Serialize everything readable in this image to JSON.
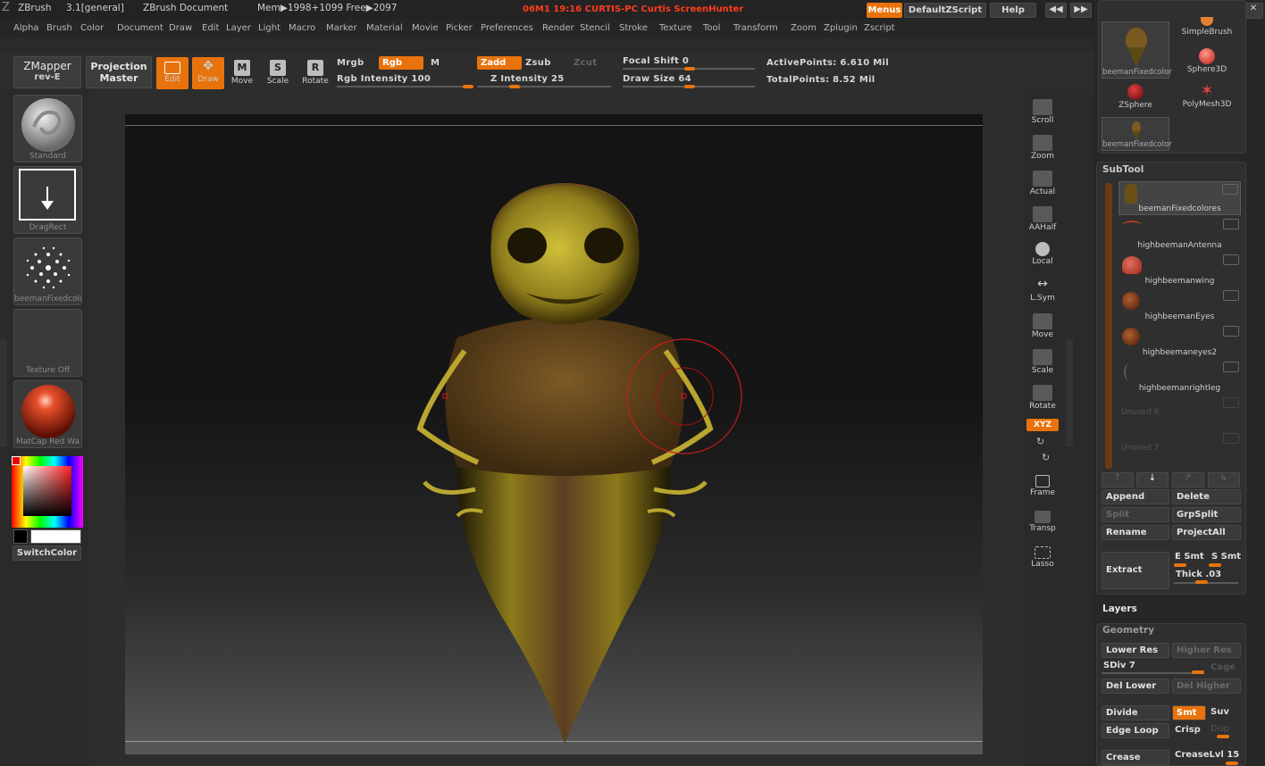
{
  "titlebar": {
    "app": "ZBrush",
    "version": "3.1[general]",
    "document": "ZBrush Document",
    "mem": "Mem▶1998+1099 Free▶2097",
    "status": "06M1 19:16 CURTIS-PC Curtis ScreenHunter",
    "menus_btn": "Menus",
    "script_btn": "DefaultZScript",
    "help_btn": "Help"
  },
  "menu": [
    "Alpha",
    "Brush",
    "Color",
    "Document",
    "Draw",
    "Edit",
    "Layer",
    "Light",
    "Macro",
    "Marker",
    "Material",
    "Movie",
    "Picker",
    "Preferences",
    "Render",
    "Stencil",
    "Stroke",
    "Texture",
    "Tool",
    "Transform",
    "Zoom",
    "Zplugin",
    "Zscript"
  ],
  "shelf": {
    "zmapper": "ZMapper",
    "zmapper_sub": "rev-E",
    "projection": "Projection",
    "projection_sub": "Master",
    "edit": "Edit",
    "draw": "Draw",
    "move": "Move",
    "scale": "Scale",
    "rotate": "Rotate",
    "mrgb": "Mrgb",
    "rgb": "Rgb",
    "m": "M",
    "rgb_intensity": "Rgb Intensity 100",
    "zadd": "Zadd",
    "zsub": "Zsub",
    "zcut": "Zcut",
    "z_intensity": "Z Intensity 25",
    "focal_shift": "Focal Shift 0",
    "draw_size": "Draw Size 64",
    "active_points": "ActivePoints: 6.610 Mil",
    "total_points": "TotalPoints: 8.52 Mil"
  },
  "left": {
    "brush": "Standard",
    "stroke": "DragRect",
    "alpha": "beemanFixedcolor",
    "texture": "Texture  Off",
    "material": "MatCap Red Wa",
    "switch_color": "SwitchColor",
    "colors": {
      "primary": "#000000",
      "secondary": "#ffffff"
    }
  },
  "vtools": [
    "Scroll",
    "Zoom",
    "Actual",
    "AAHalf",
    "Local",
    "L.Sym",
    "Move",
    "Scale",
    "Rotate",
    "XYZ",
    "Frame",
    "Transp",
    "Lasso"
  ],
  "tools_top": [
    {
      "name": "beemanFixedcolor"
    },
    {
      "name": "SimpleBrush"
    },
    {
      "name": "Sphere3D"
    },
    {
      "name": "ZSphere"
    },
    {
      "name": "PolyMesh3D"
    },
    {
      "name": "beemanFixedcolor"
    }
  ],
  "subtool": {
    "title": "SubTool",
    "items": [
      "beemanFixedcolores",
      "highbeemanAntenna",
      "highbeemanwing",
      "highbeemanEyes",
      "highbeemaneyes2",
      "highbeemanrightleg",
      "Unused  6",
      "Unused  7"
    ],
    "append": "Append",
    "delete": "Delete",
    "split": "Split",
    "grpsplit": "GrpSplit",
    "rename": "Rename",
    "projectall": "ProjectAll",
    "extract": "Extract",
    "e_smt": "E Smt",
    "s_smt": "S Smt",
    "thick": "Thick .03"
  },
  "layers": {
    "title": "Layers"
  },
  "geometry": {
    "title": "Geometry",
    "lower_res": "Lower Res",
    "higher_res": "Higher Res",
    "sdiv": "SDiv 7",
    "cage": "Cage",
    "del_lower": "Del Lower",
    "del_higher": "Del Higher",
    "divide": "Divide",
    "smt": "Smt",
    "suv": "Suv",
    "edge_loop": "Edge Loop",
    "crisp": "Crisp",
    "disp": "Disp",
    "crease": "Crease",
    "creaselvl": "CreaseLvl 15"
  },
  "accent": "#e8730c"
}
